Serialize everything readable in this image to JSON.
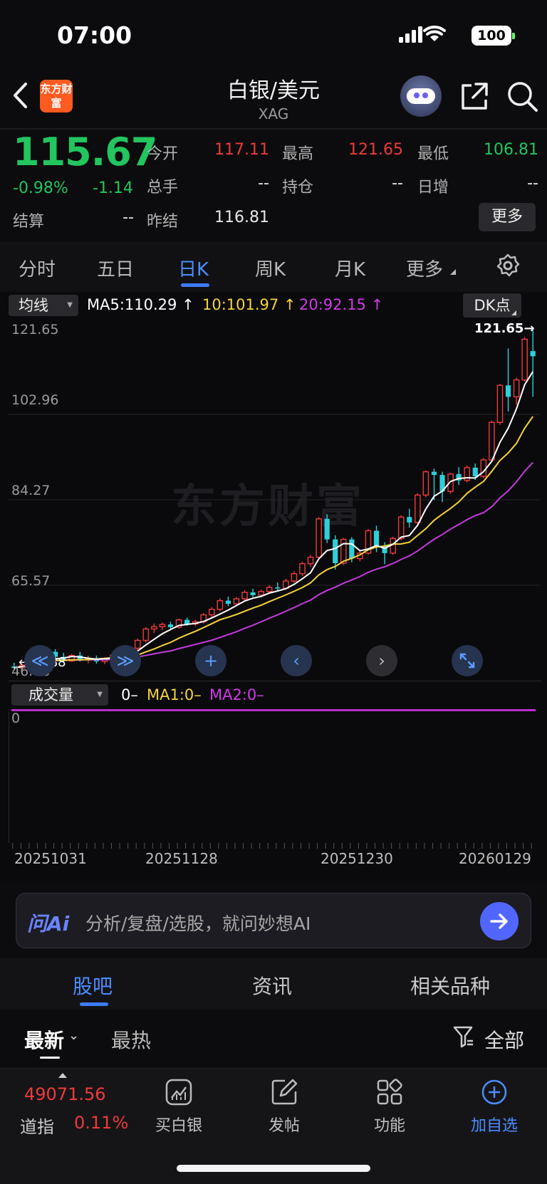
{
  "status_bar": {
    "time": "07:00",
    "battery": "100"
  },
  "header": {
    "logo_text": "东方财富",
    "title": "白银/美元",
    "code": "XAG"
  },
  "quote": {
    "price": "115.67",
    "change_pct": "-0.98%",
    "change": "-1.14",
    "fields": {
      "open_label": "今开",
      "open": "117.11",
      "high_label": "最高",
      "high": "121.65",
      "low_label": "最低",
      "low": "106.81",
      "volume_label": "总手",
      "volume": "--",
      "position_label": "持仓",
      "position": "--",
      "daily_inc_label": "日增",
      "daily_inc": "--",
      "settle_label": "结算",
      "settle": "--",
      "prev_settle_label": "昨结",
      "prev_settle": "116.81"
    },
    "more_label": "更多"
  },
  "chart_tabs": [
    "分时",
    "五日",
    "日K",
    "周K",
    "月K",
    "更多"
  ],
  "chart_tab_active": "日K",
  "chart_data": {
    "type": "candlestick",
    "ma_selector": "均线",
    "ma5_label": "MA5:110.29",
    "ma10_label": "10:101.97",
    "ma20_label": "20:92.15",
    "dk_label": "DK点",
    "y_ticks": [
      "121.65",
      "102.96",
      "84.27",
      "65.57"
    ],
    "y_min_label": "46.88",
    "y_max": 121.65,
    "y_min": 46.88,
    "max_marker": "121.65→",
    "min_marker": "←46.88",
    "x_ticks": [
      "20251031",
      "20251128",
      "20251230",
      "20260129"
    ],
    "watermark": "东方财富",
    "volume_selector": "成交量",
    "volume_value": "0–",
    "vol_ma1": "MA1:0–",
    "vol_ma2": "MA2:0–",
    "vol_axis_zero": "0",
    "colors": {
      "up": "#ef3a3a",
      "down": "#2ecfd9",
      "ma5": "#ffffff",
      "ma10": "#f5d33a",
      "ma20": "#c43adb"
    },
    "candles": [
      [
        47.8,
        48.6,
        46.9,
        47.5
      ],
      [
        47.5,
        48.4,
        47.0,
        48.1
      ],
      [
        48.1,
        49.0,
        47.6,
        48.5
      ],
      [
        48.5,
        50.3,
        48.0,
        49.8
      ],
      [
        49.8,
        51.4,
        49.2,
        51.0
      ],
      [
        51.0,
        51.6,
        49.4,
        49.9
      ],
      [
        49.9,
        50.8,
        48.6,
        49.0
      ],
      [
        49.0,
        50.5,
        48.8,
        50.2
      ],
      [
        50.2,
        51.0,
        48.9,
        49.3
      ],
      [
        49.3,
        50.1,
        48.5,
        49.6
      ],
      [
        49.6,
        50.2,
        48.4,
        48.9
      ],
      [
        48.9,
        49.8,
        48.3,
        49.4
      ],
      [
        49.4,
        50.6,
        49.0,
        50.3
      ],
      [
        50.3,
        51.2,
        49.7,
        50.9
      ],
      [
        50.9,
        52.2,
        50.4,
        51.8
      ],
      [
        51.8,
        53.9,
        51.3,
        53.5
      ],
      [
        53.5,
        56.4,
        53.0,
        56.0
      ],
      [
        56.0,
        57.2,
        55.1,
        56.5
      ],
      [
        56.5,
        57.4,
        55.8,
        57.0
      ],
      [
        57.0,
        57.6,
        56.0,
        56.4
      ],
      [
        56.4,
        58.3,
        56.1,
        58.0
      ],
      [
        58.0,
        58.5,
        56.7,
        57.1
      ],
      [
        57.1,
        58.0,
        56.6,
        57.6
      ],
      [
        57.6,
        59.5,
        57.2,
        59.1
      ],
      [
        59.1,
        60.8,
        58.6,
        60.3
      ],
      [
        60.3,
        62.7,
        59.9,
        62.2
      ],
      [
        62.2,
        63.1,
        61.0,
        61.5
      ],
      [
        61.5,
        63.0,
        61.0,
        62.6
      ],
      [
        62.6,
        64.5,
        62.1,
        64.0
      ],
      [
        64.0,
        64.8,
        63.0,
        63.4
      ],
      [
        63.4,
        64.6,
        63.0,
        64.2
      ],
      [
        64.2,
        65.6,
        63.8,
        65.1
      ],
      [
        65.1,
        66.2,
        64.4,
        64.9
      ],
      [
        64.9,
        67.0,
        64.6,
        66.5
      ],
      [
        66.5,
        68.6,
        66.1,
        68.1
      ],
      [
        68.1,
        70.7,
        67.6,
        70.3
      ],
      [
        70.3,
        72.2,
        69.6,
        71.7
      ],
      [
        71.7,
        80.5,
        71.2,
        80.1
      ],
      [
        80.1,
        81.1,
        74.8,
        75.6
      ],
      [
        75.6,
        76.5,
        69.0,
        70.4
      ],
      [
        70.4,
        75.9,
        70.0,
        75.6
      ],
      [
        75.6,
        76.1,
        70.6,
        71.4
      ],
      [
        71.4,
        73.1,
        70.8,
        72.6
      ],
      [
        72.6,
        77.9,
        72.3,
        77.5
      ],
      [
        77.5,
        78.6,
        72.8,
        74.1
      ],
      [
        74.1,
        75.0,
        70.2,
        72.6
      ],
      [
        72.6,
        76.2,
        72.2,
        75.8
      ],
      [
        75.8,
        80.9,
        75.4,
        80.5
      ],
      [
        80.5,
        82.3,
        78.2,
        79.3
      ],
      [
        79.3,
        85.7,
        78.9,
        85.3
      ],
      [
        85.3,
        90.7,
        84.8,
        90.4
      ],
      [
        90.4,
        91.1,
        84.2,
        89.7
      ],
      [
        89.7,
        90.4,
        83.8,
        86.1
      ],
      [
        86.1,
        90.2,
        85.6,
        89.9
      ],
      [
        89.9,
        91.4,
        87.5,
        88.5
      ],
      [
        88.5,
        91.8,
        88.1,
        91.3
      ],
      [
        91.3,
        92.2,
        88.6,
        89.4
      ],
      [
        89.4,
        93.4,
        89.0,
        93.0
      ],
      [
        93.0,
        101.6,
        92.6,
        101.2
      ],
      [
        101.2,
        109.6,
        100.7,
        109.3
      ],
      [
        109.3,
        117.4,
        103.6,
        106.8
      ],
      [
        106.8,
        111.0,
        105.1,
        110.5
      ],
      [
        110.5,
        119.8,
        110.1,
        119.4
      ],
      [
        116.8,
        121.65,
        106.81,
        115.67
      ]
    ]
  },
  "chart_controls": [
    "zoom-out",
    "zoom-in",
    "plus",
    "prev",
    "next",
    "fullscreen"
  ],
  "ai_bar": {
    "logo": "问Ai",
    "placeholder": "分析/复盘/选股，就问妙想AI"
  },
  "section_tabs": [
    "股吧",
    "资讯",
    "相关品种"
  ],
  "section_tab_active": "股吧",
  "filters": {
    "latest": "最新",
    "hot": "最热",
    "all": "全部"
  },
  "bottom_nav": {
    "index_value": "49071.56",
    "index_name": "道指",
    "index_pct": "0.11%",
    "items": [
      "买白银",
      "发帖",
      "功能",
      "加自选"
    ]
  }
}
